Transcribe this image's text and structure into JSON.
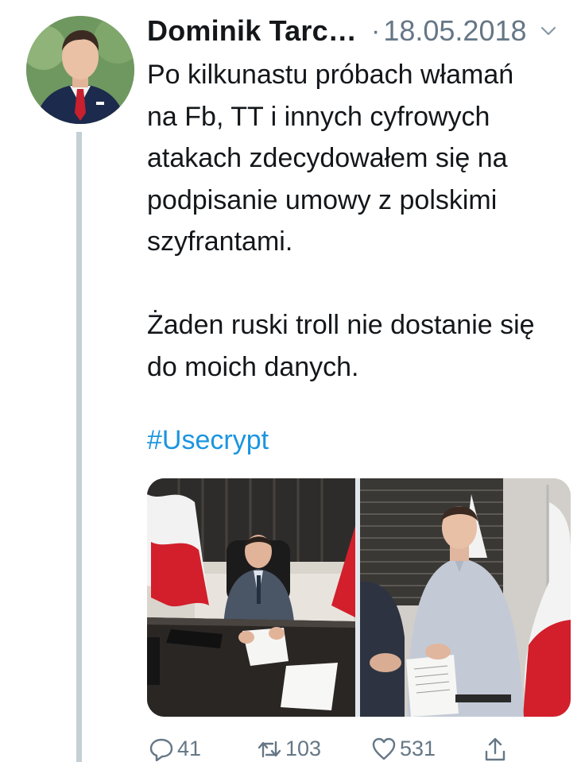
{
  "tweet": {
    "author": {
      "name": "Dominik Tarc…",
      "avatar": "profile-photo"
    },
    "separator": "·",
    "date": "18.05.2018",
    "menu_icon": "chevron-down-icon",
    "text": "Po kilkunastu próbach włamań\nna Fb, TT i innych cyfrowych\natakach zdecydowałem się na\npodpisanie umowy z polskimi\nszyfrantami.\n\nŻaden ruski troll nie dostanie się\ndo moich danych.",
    "hashtag": "#Usecrypt",
    "media": [
      {
        "name": "photo-signing-at-desk"
      },
      {
        "name": "photo-handshake"
      }
    ],
    "actions": {
      "replies": "41",
      "retweets": "103",
      "likes": "531"
    },
    "colors": {
      "text": "#14171a",
      "secondary": "#657786",
      "link": "#1b95e0",
      "thread_line": "#c4cfd6"
    }
  }
}
